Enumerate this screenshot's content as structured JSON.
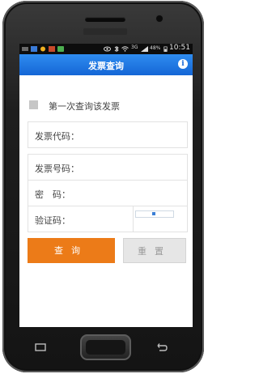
{
  "statusbar": {
    "signal_label": "3G",
    "battery": "48%",
    "time": "10:51"
  },
  "titlebar": {
    "title": "发票查询",
    "info_glyph": "i"
  },
  "form": {
    "first_query_label": "第一次查询该发票",
    "invoice_code_label": "发票代码：",
    "invoice_number_label": "发票号码：",
    "password_label": "密　码：",
    "captcha_label": "验证码："
  },
  "buttons": {
    "query": "查询",
    "reset": "重置"
  },
  "colors": {
    "title_bar": "#1466d6",
    "query_button": "#ec7b18",
    "reset_button": "#e6e6e6"
  }
}
